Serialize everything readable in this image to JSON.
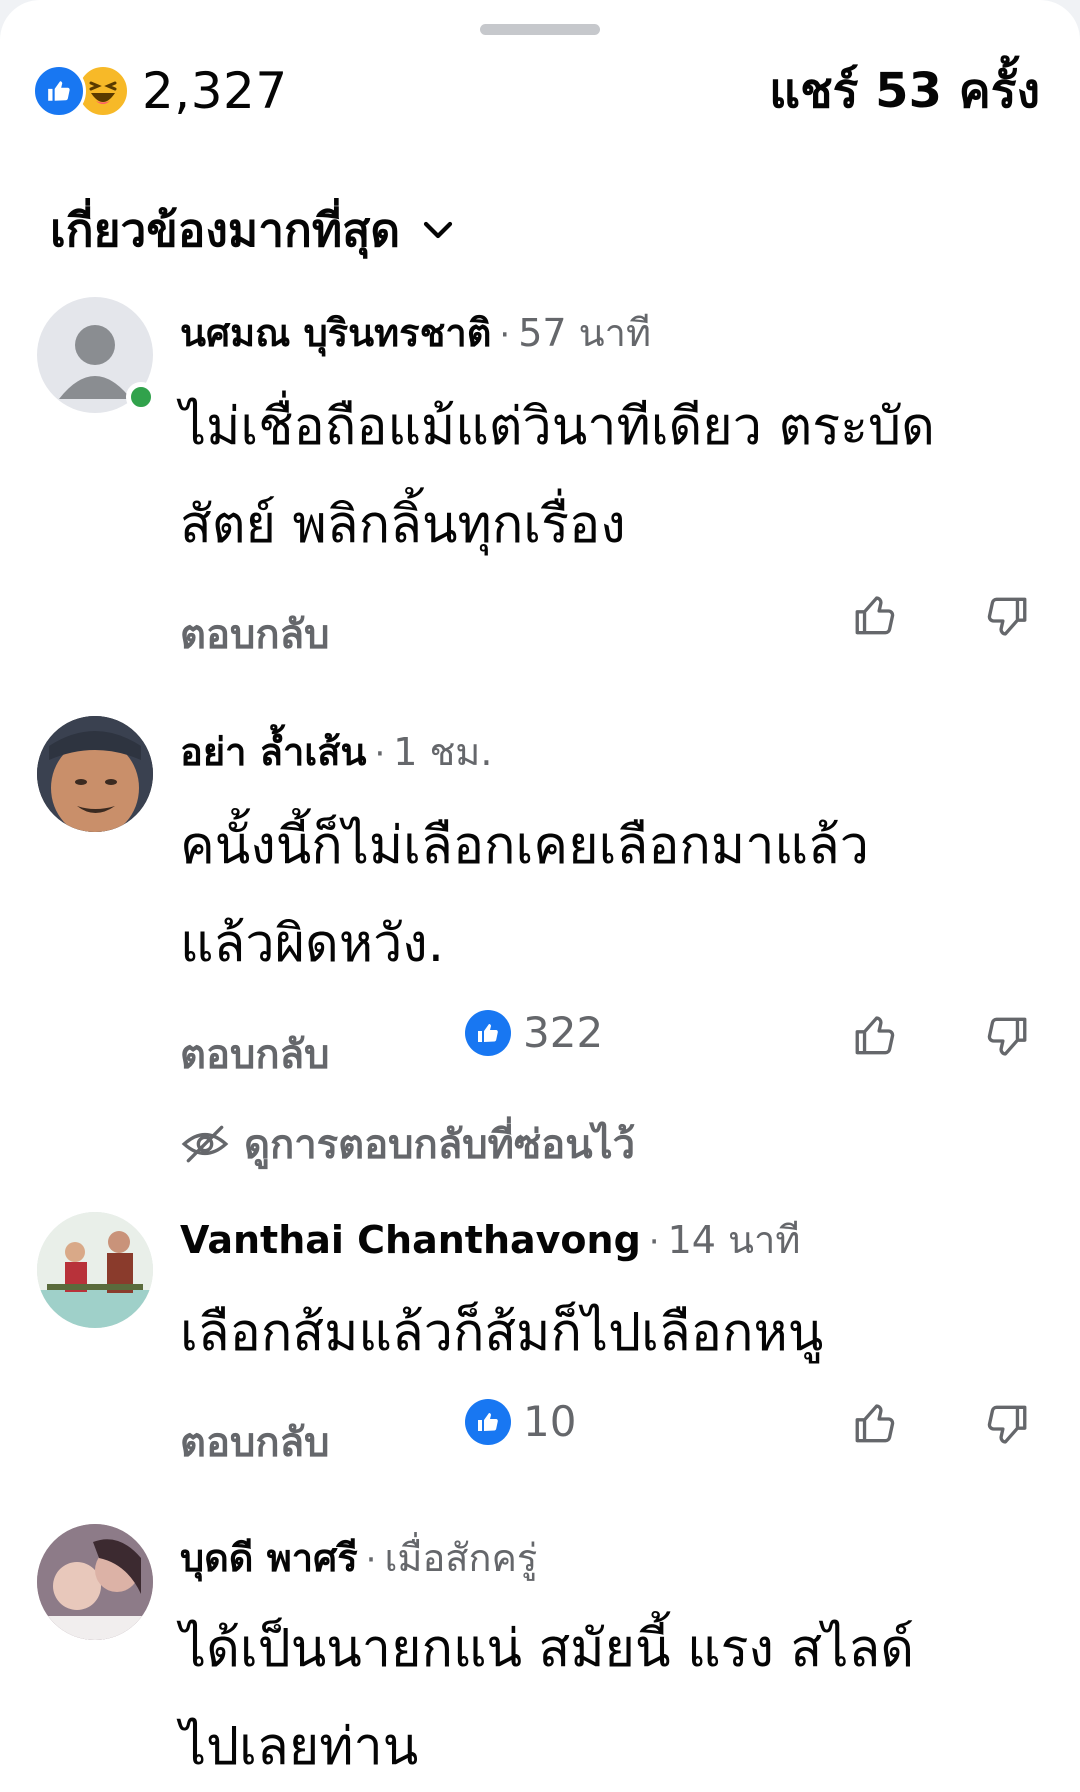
{
  "summary": {
    "reaction_count": "2,327",
    "share_text": "แชร์ 53 ครั้ง"
  },
  "sort": {
    "label": "เกี่ยวข้องมากที่สุด"
  },
  "actions": {
    "reply_label": "ตอบกลับ"
  },
  "hidden_replies_label": "ดูการตอบกลับที่ซ่อนไว้",
  "comments": [
    {
      "author": "นศมณ บุรินทรชาติ",
      "time": "57 นาที",
      "lines": [
        "ไม่เชื่อถือแม้แต่วินาทีเดียว ตระบัด",
        "สัตย์ พลิกลิ้นทุกเรื่อง"
      ],
      "reactions": ""
    },
    {
      "author": "อย่า ล้ำเส้น",
      "time": "1 ชม.",
      "lines": [
        "คนั้งนี้ก็ไม่เลือกเคยเลือกมาแล้ว",
        "แล้วผิดหวัง."
      ],
      "reactions": "322"
    },
    {
      "author": "Vanthai Chanthavong",
      "time": "14 นาที",
      "lines": [
        "เลือกส้มแล้วก็ส้มก็ไปเลือกหนู"
      ],
      "reactions": "10"
    },
    {
      "author": "บุดดี พาศรี",
      "time": "เมื่อสักครู่",
      "lines": [
        "ได้เป็นนายกแน่ สมัยนี้ แรง สไลด์",
        "ไปเลยท่าน"
      ],
      "reactions": ""
    }
  ],
  "colors": {
    "like_blue": "#1877f2",
    "haha_yellow": "#f7b928",
    "secondary_text": "#65676b",
    "online_green": "#31a24c"
  }
}
